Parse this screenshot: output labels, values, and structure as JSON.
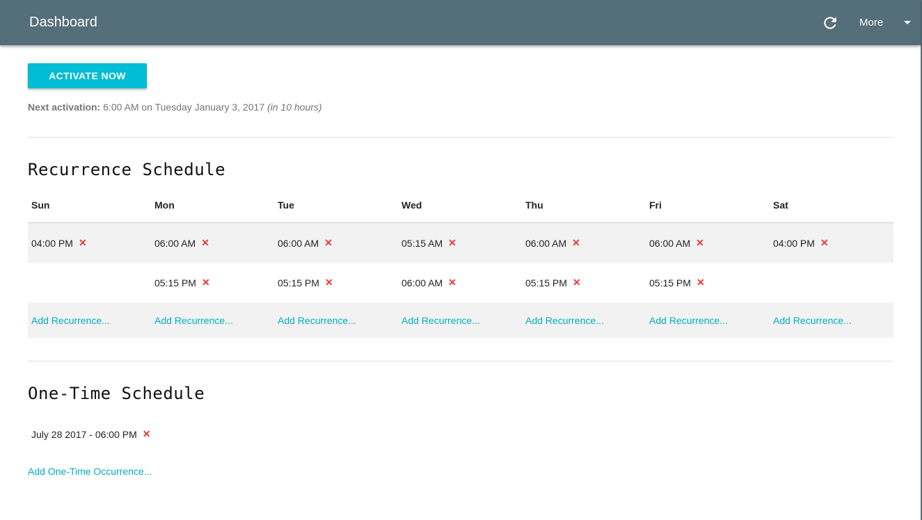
{
  "header": {
    "title": "Dashboard",
    "more_label": "More",
    "refresh_icon": "refresh-icon",
    "dropdown_icon": "chevron-down-icon",
    "bar_color": "#546e7a"
  },
  "activate": {
    "label": "ACTIVATE NOW",
    "color": "#00bcd4"
  },
  "next_activation": {
    "label": "Next activation:",
    "value": "6:00 AM on Tuesday January 3, 2017",
    "relative": "(in 10 hours)"
  },
  "recurrence": {
    "title": "Recurrence Schedule",
    "add_label": "Add Recurrence...",
    "days": [
      {
        "name": "Sun",
        "times": [
          "04:00 PM"
        ]
      },
      {
        "name": "Mon",
        "times": [
          "06:00 AM",
          "05:15 PM"
        ]
      },
      {
        "name": "Tue",
        "times": [
          "06:00 AM",
          "05:15 PM"
        ]
      },
      {
        "name": "Wed",
        "times": [
          "05:15 AM",
          "06:00 AM"
        ]
      },
      {
        "name": "Thu",
        "times": [
          "06:00 AM",
          "05:15 PM"
        ]
      },
      {
        "name": "Fri",
        "times": [
          "06:00 AM",
          "05:15 PM"
        ]
      },
      {
        "name": "Sat",
        "times": [
          "04:00 PM"
        ]
      }
    ]
  },
  "one_time": {
    "title": "One-Time Schedule",
    "items": [
      "July 28 2017 - 06:00 PM"
    ],
    "add_label": "Add One-Time Occurrence..."
  },
  "remove_glyph": "✕",
  "colors": {
    "remove": "#e53935",
    "link": "#00acc1"
  }
}
